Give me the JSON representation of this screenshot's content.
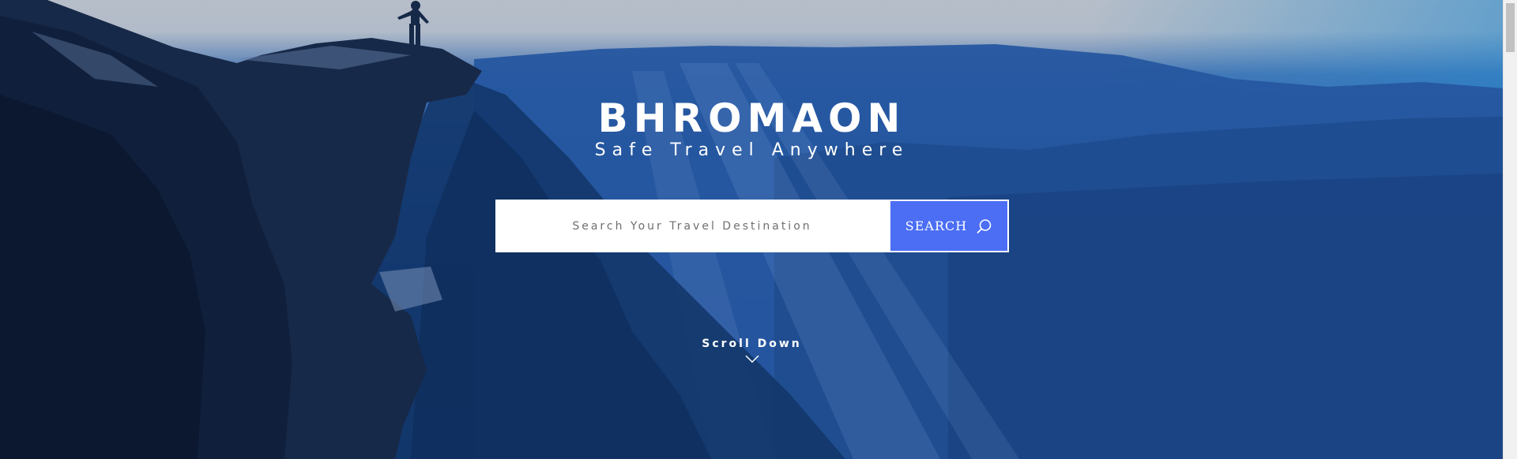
{
  "hero": {
    "brand": "BHROMAON",
    "tagline": "Safe Travel Anywhere",
    "accent_color": "#4b6ef5"
  },
  "search": {
    "placeholder": "Search Your Travel Destination",
    "value": "",
    "button_label": "SEARCH",
    "button_icon": "search-icon"
  },
  "scroll": {
    "label": "Scroll Down",
    "icon": "chevron-down-icon"
  }
}
